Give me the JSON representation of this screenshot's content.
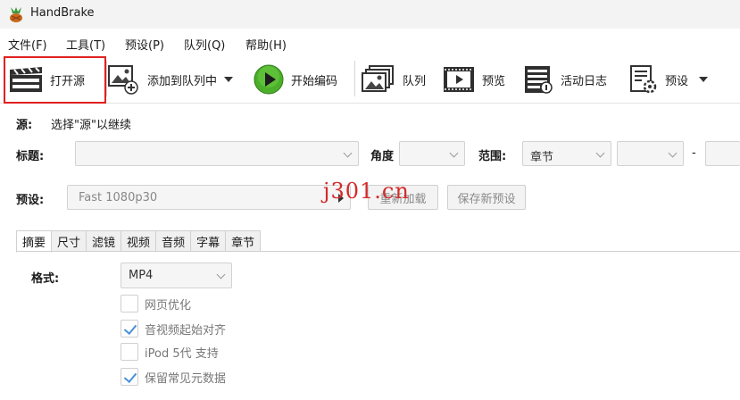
{
  "window": {
    "title": "HandBrake"
  },
  "menu": [
    {
      "label": "文件(F)"
    },
    {
      "label": "工具(T)"
    },
    {
      "label": "预设(P)"
    },
    {
      "label": "队列(Q)"
    },
    {
      "label": "帮助(H)"
    }
  ],
  "toolbar": {
    "open_source": "打开源",
    "add_to_queue": "添加到队列中",
    "start_encode": "开始编码",
    "queue": "队列",
    "preview": "预览",
    "activity_log": "活动日志",
    "presets": "预设",
    "highlight_color": "#e02020"
  },
  "source": {
    "label": "源:",
    "value": "选择\"源\"以继续"
  },
  "title_row": {
    "title_label": "标题:",
    "angle_label": "角度",
    "range_label": "范围:",
    "range_type": "章节",
    "range_dash": "-"
  },
  "preset_row": {
    "label": "预设:",
    "value": "Fast 1080p30",
    "reload_button": "重新加载",
    "save_button": "保存新预设"
  },
  "watermark": "j301.cn",
  "tabs": [
    "摘要",
    "尺寸",
    "滤镜",
    "视频",
    "音频",
    "字幕",
    "章节"
  ],
  "summary": {
    "format_label": "格式:",
    "format_value": "MP4",
    "options": [
      {
        "label": "网页优化",
        "checked": false
      },
      {
        "label": "音视频起始对齐",
        "checked": true
      },
      {
        "label": "iPod 5代 支持",
        "checked": false
      },
      {
        "label": "保留常见元数据",
        "checked": true
      }
    ]
  }
}
